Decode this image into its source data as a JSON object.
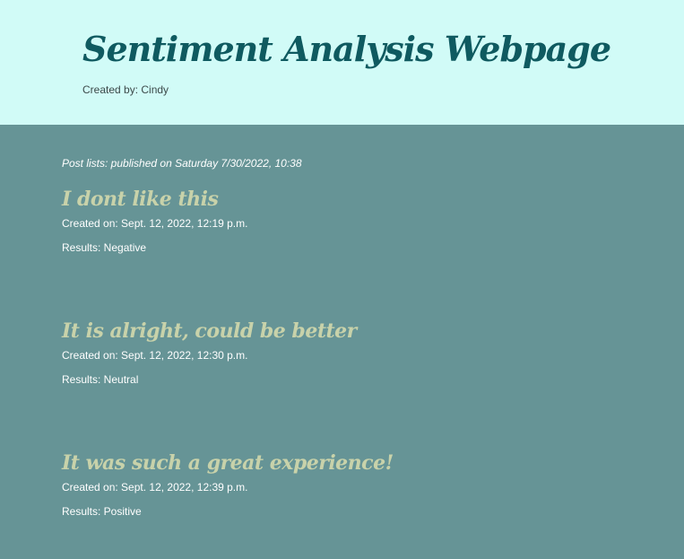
{
  "header": {
    "title": "Sentiment Analysis Webpage",
    "byline": "Created by: Cindy"
  },
  "main": {
    "published": "Post lists: published on Saturday 7/30/2022, 10:38",
    "posts": [
      {
        "title": "I dont like this",
        "created": "Created on: Sept. 12, 2022, 12:19 p.m.",
        "result": "Results: Negative"
      },
      {
        "title": "It is alright, could be better",
        "created": "Created on: Sept. 12, 2022, 12:30 p.m.",
        "result": "Results: Neutral"
      },
      {
        "title": "It was such a great experience!",
        "created": "Created on: Sept. 12, 2022, 12:39 p.m.",
        "result": "Results: Positive"
      }
    ]
  },
  "colors": {
    "header_bg": "#d1fbf7",
    "page_bg": "#669496",
    "title_color": "#0f5a60",
    "post_title_color": "#c8d2aa"
  }
}
